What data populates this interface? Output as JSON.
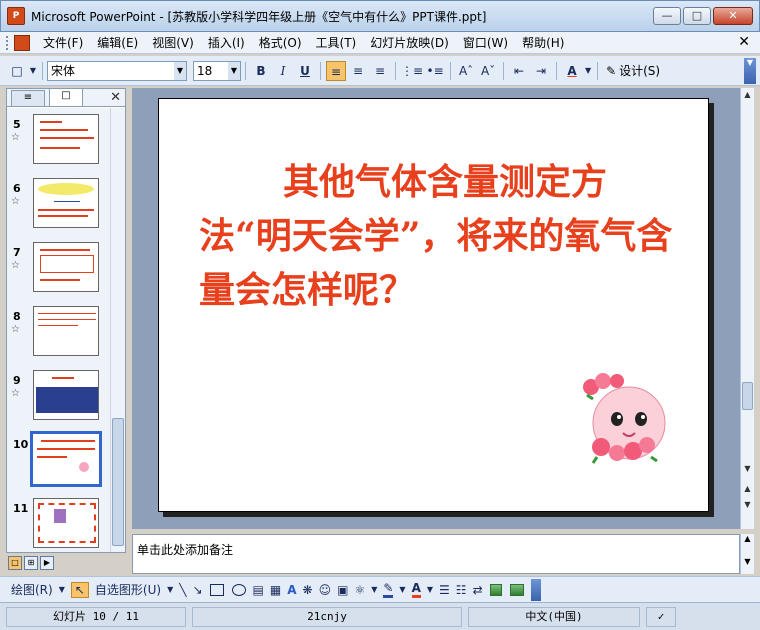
{
  "window": {
    "title": "Microsoft PowerPoint - [苏教版小学科学四年级上册《空气中有什么》PPT课件.ppt]",
    "app_icon": "P"
  },
  "menu": [
    "文件(F)",
    "编辑(E)",
    "视图(V)",
    "插入(I)",
    "格式(O)",
    "工具(T)",
    "幻灯片放映(D)",
    "窗口(W)",
    "帮助(H)"
  ],
  "toolbar": {
    "font": "宋体",
    "size": "18",
    "bold": "B",
    "italic": "I",
    "underline": "U",
    "design": "设计(S)"
  },
  "thumbnails": [
    {
      "num": "5"
    },
    {
      "num": "6"
    },
    {
      "num": "7"
    },
    {
      "num": "8"
    },
    {
      "num": "9"
    },
    {
      "num": "10"
    },
    {
      "num": "11"
    }
  ],
  "slide": {
    "title": "其他气体含量测定方法“明天会学”，将来的氧气含量会怎样呢？"
  },
  "notes": {
    "placeholder": "单击此处添加备注"
  },
  "drawbar": {
    "draw": "绘图(R)",
    "autoshapes": "自选图形(U)"
  },
  "status": {
    "slide": "幻灯片 10 / 11",
    "design": "21cnjy",
    "lang": "中文(中国)"
  },
  "colors": {
    "title_red": "#e8401c",
    "current_thumb_border": "#3366cc",
    "slide_area_bg": "#8e9fba"
  }
}
